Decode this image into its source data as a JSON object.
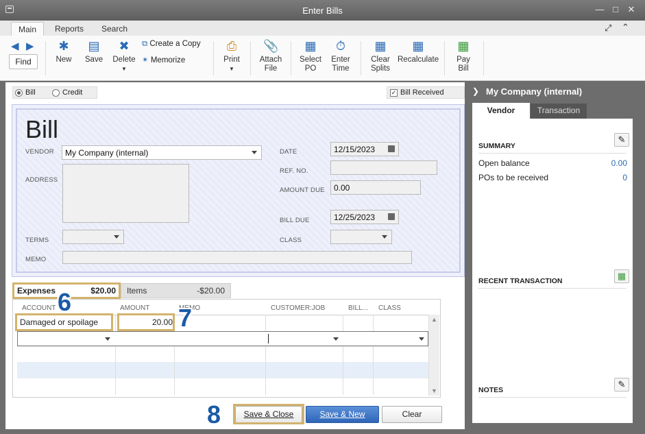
{
  "window": {
    "title": "Enter Bills"
  },
  "tabs": [
    "Main",
    "Reports",
    "Search"
  ],
  "toolbar": {
    "find": "Find",
    "new": "New",
    "save": "Save",
    "delete": "Delete",
    "create_copy": "Create a Copy",
    "memorize": "Memorize",
    "print": "Print",
    "attach_l1": "Attach",
    "attach_l2": "File",
    "select_l1": "Select",
    "select_l2": "PO",
    "enter_l1": "Enter",
    "enter_l2": "Time",
    "clear_l1": "Clear",
    "clear_l2": "Splits",
    "recalculate": "Recalculate",
    "pay_l1": "Pay",
    "pay_l2": "Bill"
  },
  "type": {
    "bill": "Bill",
    "credit": "Credit",
    "bill_received": "Bill Received",
    "selected": "Bill"
  },
  "form": {
    "heading": "Bill",
    "vendor_label": "VENDOR",
    "vendor": "My Company (internal)",
    "address_label": "ADDRESS",
    "terms_label": "TERMS",
    "memo_label": "MEMO",
    "date_label": "DATE",
    "date": "12/15/2023",
    "ref_label": "REF. NO.",
    "amount_due_label": "AMOUNT DUE",
    "amount_due": "0.00",
    "bill_due_label": "BILL DUE",
    "bill_due": "12/25/2023",
    "class_label": "CLASS"
  },
  "detail_tabs": {
    "expenses_label": "Expenses",
    "expenses_amount": "$20.00",
    "items_label": "Items",
    "items_amount": "-$20.00"
  },
  "grid": {
    "columns": [
      "ACCOUNT",
      "AMOUNT",
      "MEMO",
      "CUSTOMER:JOB",
      "BILL...",
      "CLASS"
    ],
    "rows": [
      {
        "account": "Damaged or spoilage",
        "amount": "20.00"
      }
    ]
  },
  "steps": {
    "six": "6",
    "seven": "7",
    "eight": "8"
  },
  "buttons": {
    "save_close": "Save & Close",
    "save_new": "Save & New",
    "clear": "Clear"
  },
  "sidebar": {
    "title": "My Company (internal)",
    "tab_vendor": "Vendor",
    "tab_transaction": "Transaction",
    "summary": "SUMMARY",
    "open_balance_label": "Open balance",
    "open_balance": "0.00",
    "pos_label": "POs to be received",
    "pos": "0",
    "recent": "RECENT TRANSACTION",
    "notes": "NOTES"
  },
  "colors": {
    "accent": "#2c6bb5",
    "highlight": "#d3b36b",
    "form_bg": "#eef0fb"
  }
}
